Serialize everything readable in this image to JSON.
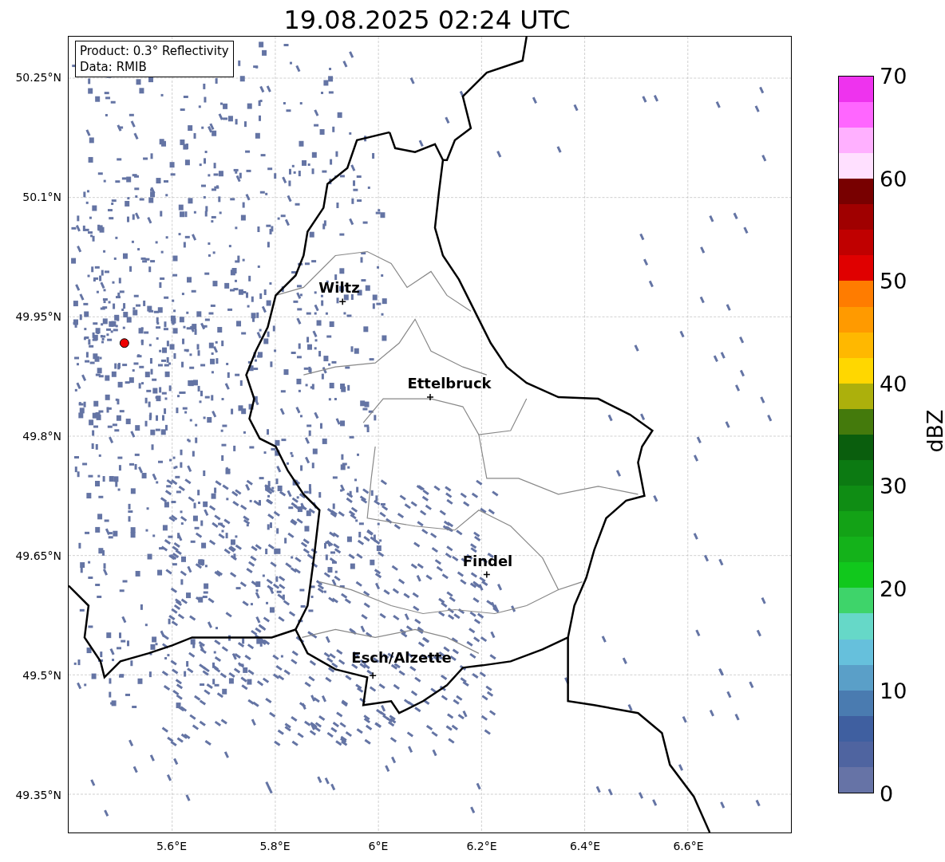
{
  "title": "19.08.2025 02:24 UTC",
  "info_box": [
    "Product: 0.3° Reflectivity",
    "Data: RMIB"
  ],
  "y_ticks": [
    "50.25°N",
    "50.1°N",
    "49.95°N",
    "49.8°N",
    "49.65°N",
    "49.5°N",
    "49.35°N"
  ],
  "x_ticks": [
    "5.6°E",
    "5.8°E",
    "6°E",
    "6.2°E",
    "6.4°E",
    "6.6°E"
  ],
  "cities": [
    {
      "name": "Wiltz"
    },
    {
      "name": "Ettelbruck"
    },
    {
      "name": "Findel"
    },
    {
      "name": "Esch/Alzette"
    }
  ],
  "colorbar": {
    "label": "dBZ",
    "ticks": [
      "70",
      "60",
      "50",
      "40",
      "30",
      "20",
      "10",
      "0"
    ],
    "segments": [
      {
        "color": "#6673a6"
      },
      {
        "color": "#4f64a0"
      },
      {
        "color": "#3f5fa0"
      },
      {
        "color": "#4a7bb0"
      },
      {
        "color": "#5a9fc8"
      },
      {
        "color": "#66c0dc"
      },
      {
        "color": "#66d8c8"
      },
      {
        "color": "#3ed46a"
      },
      {
        "color": "#11c81c"
      },
      {
        "color": "#14b21a"
      },
      {
        "color": "#13a216"
      },
      {
        "color": "#0f8d14"
      },
      {
        "color": "#0c7a12"
      },
      {
        "color": "#0a5e0d"
      },
      {
        "color": "#447a0c"
      },
      {
        "color": "#acb00c"
      },
      {
        "color": "#ffd700"
      },
      {
        "color": "#ffb800"
      },
      {
        "color": "#ff9a00"
      },
      {
        "color": "#ff7c00"
      },
      {
        "color": "#e00000"
      },
      {
        "color": "#c00000"
      },
      {
        "color": "#a00000"
      },
      {
        "color": "#780000"
      },
      {
        "color": "#ffe0ff"
      },
      {
        "color": "#ffb0ff"
      },
      {
        "color": "#ff66ff"
      },
      {
        "color": "#ee33ee"
      }
    ]
  }
}
